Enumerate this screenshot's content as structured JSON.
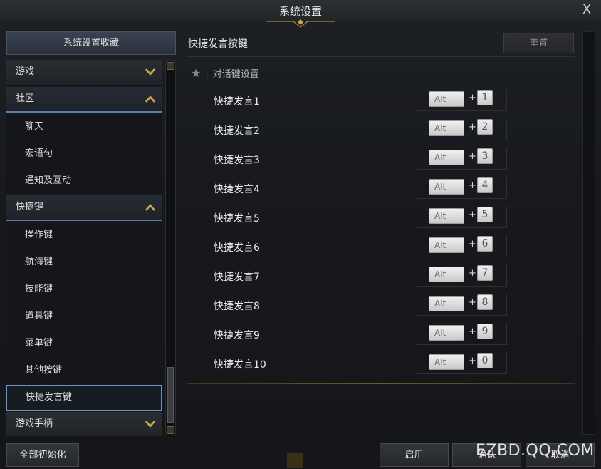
{
  "window": {
    "title": "系统设置",
    "close_label": "X"
  },
  "sidebar": {
    "favorites_label": "系统设置收藏",
    "items": [
      {
        "type": "cat",
        "label": "游戏",
        "open": false
      },
      {
        "type": "cat",
        "label": "社区",
        "open": true
      },
      {
        "type": "sub",
        "label": "聊天"
      },
      {
        "type": "sub",
        "label": "宏语句"
      },
      {
        "type": "sub",
        "label": "通知及互动"
      },
      {
        "type": "cat",
        "label": "快捷键",
        "open": true
      },
      {
        "type": "sub",
        "label": "操作键"
      },
      {
        "type": "sub",
        "label": "航海键"
      },
      {
        "type": "sub",
        "label": "技能键"
      },
      {
        "type": "sub",
        "label": "道具键"
      },
      {
        "type": "sub",
        "label": "菜单键"
      },
      {
        "type": "sub",
        "label": "其他按键"
      },
      {
        "type": "sub",
        "label": "快捷发言键",
        "selected": true
      },
      {
        "type": "cat",
        "label": "游戏手柄",
        "open": false
      }
    ]
  },
  "main": {
    "section_title": "快捷发言按键",
    "reset_label": "重置",
    "group_label": "对话键设置",
    "modifier_label": "Alt",
    "plus_label": "+",
    "bindings": [
      {
        "label": "快捷发言1",
        "key": "1"
      },
      {
        "label": "快捷发言2",
        "key": "2"
      },
      {
        "label": "快捷发言3",
        "key": "3"
      },
      {
        "label": "快捷发言4",
        "key": "4"
      },
      {
        "label": "快捷发言5",
        "key": "5"
      },
      {
        "label": "快捷发言6",
        "key": "6"
      },
      {
        "label": "快捷发言7",
        "key": "7"
      },
      {
        "label": "快捷发言8",
        "key": "8"
      },
      {
        "label": "快捷发言9",
        "key": "9"
      },
      {
        "label": "快捷发言10",
        "key": "0"
      }
    ]
  },
  "footer": {
    "init_all_label": "全部初始化",
    "apply_label": "启用",
    "ok_label": "确认",
    "cancel_label": "取消"
  },
  "watermark": "EZBD.QQ.COM",
  "colors": {
    "accent_gold": "#c9a84a",
    "selected_border": "#6e90c8"
  }
}
